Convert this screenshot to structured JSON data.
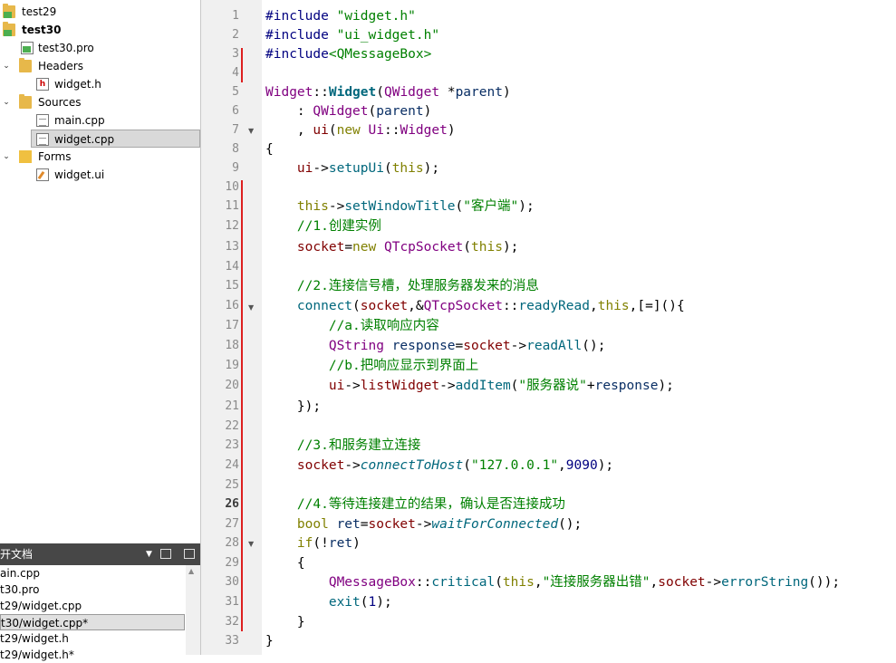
{
  "project_tree": {
    "items": [
      {
        "label": "test29"
      },
      {
        "label": "test30"
      },
      {
        "label": "test30.pro"
      },
      {
        "label": "Headers"
      },
      {
        "label": "widget.h"
      },
      {
        "label": "Sources"
      },
      {
        "label": "main.cpp"
      },
      {
        "label": "widget.cpp"
      },
      {
        "label": "Forms"
      },
      {
        "label": "widget.ui"
      }
    ]
  },
  "open_documents": {
    "title": "开文档",
    "items": [
      {
        "label": "ain.cpp"
      },
      {
        "label": "t30.pro"
      },
      {
        "label": "t29/widget.cpp"
      },
      {
        "label": "t30/widget.cpp*"
      },
      {
        "label": "t29/widget.h"
      },
      {
        "label": "t29/widget.h*"
      }
    ]
  },
  "editor": {
    "current_line": 26,
    "line_numbers": [
      "1",
      "2",
      "3",
      "4",
      "5",
      "6",
      "7",
      "8",
      "9",
      "10",
      "11",
      "12",
      "13",
      "14",
      "15",
      "16",
      "17",
      "18",
      "19",
      "20",
      "21",
      "22",
      "23",
      "24",
      "25",
      "26",
      "27",
      "28",
      "29",
      "30",
      "31",
      "32",
      "33"
    ],
    "code": {
      "l1": [
        "#include ",
        "\"widget.h\""
      ],
      "l2": [
        "#include ",
        "\"ui_widget.h\""
      ],
      "l3": [
        "#include",
        "<QMessageBox>"
      ],
      "l5": [
        "Widget",
        "::",
        "Widget",
        "(",
        "QWidget",
        " *",
        "parent",
        ")"
      ],
      "l6": [
        "    : ",
        "QWidget",
        "(",
        "parent",
        ")"
      ],
      "l7": [
        "    , ",
        "ui",
        "(",
        "new",
        " ",
        "Ui",
        "::",
        "Widget",
        ")"
      ],
      "l8": [
        "{"
      ],
      "l9": [
        "    ",
        "ui",
        "->",
        "setupUi",
        "(",
        "this",
        ");"
      ],
      "l11": [
        "    ",
        "this",
        "->",
        "setWindowTitle",
        "(",
        "\"客户端\"",
        ");"
      ],
      "l12": [
        "    //1.创建实例"
      ],
      "l13": [
        "    ",
        "socket",
        "=",
        "new",
        " ",
        "QTcpSocket",
        "(",
        "this",
        ");"
      ],
      "l15": [
        "    //2.连接信号槽，处理服务器发来的消息"
      ],
      "l16": [
        "    ",
        "connect",
        "(",
        "socket",
        ",&",
        "QTcpSocket",
        "::",
        "readyRead",
        ",",
        "this",
        ",[=](){"
      ],
      "l17": [
        "        //a.读取响应内容"
      ],
      "l18": [
        "        ",
        "QString",
        " ",
        "response",
        "=",
        "socket",
        "->",
        "readAll",
        "();"
      ],
      "l19": [
        "        //b.把响应显示到界面上"
      ],
      "l20": [
        "        ",
        "ui",
        "->",
        "listWidget",
        "->",
        "addItem",
        "(",
        "\"服务器说\"",
        "+",
        "response",
        ");"
      ],
      "l21": [
        "    });"
      ],
      "l23": [
        "    //3.和服务建立连接"
      ],
      "l24": [
        "    ",
        "socket",
        "->",
        "connectToHost",
        "(",
        "\"127.0.0.1\"",
        ",",
        "9090",
        ");"
      ],
      "l26": [
        "    //4.等待连接建立的结果，确认是否连接成功"
      ],
      "l27": [
        "    ",
        "bool",
        " ",
        "ret",
        "=",
        "socket",
        "->",
        "waitForConnected",
        "();"
      ],
      "l28": [
        "    ",
        "if",
        "(!",
        "ret",
        ")"
      ],
      "l29": [
        "    {"
      ],
      "l30": [
        "        ",
        "QMessageBox",
        "::",
        "critical",
        "(",
        "this",
        ",",
        "\"连接服务器出错\"",
        ",",
        "socket",
        "->",
        "errorString",
        "());"
      ],
      "l31": [
        "        ",
        "exit",
        "(",
        "1",
        ");"
      ],
      "l32": [
        "    }"
      ],
      "l33": [
        "}"
      ]
    }
  }
}
